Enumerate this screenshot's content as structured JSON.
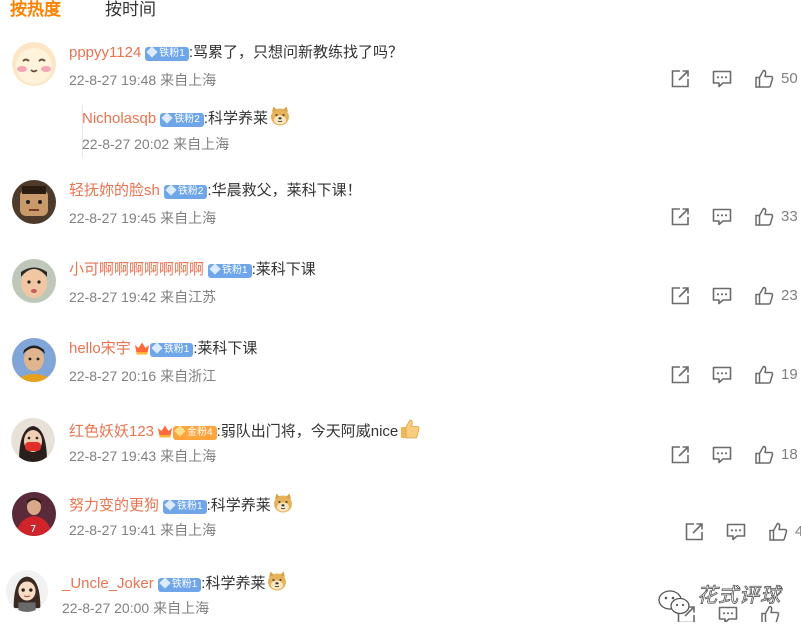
{
  "tabs": {
    "hot": "按热度",
    "time": "按时间"
  },
  "colors": {
    "accent": "#ff8200",
    "username": "#eb7350",
    "badge": "#6fa6ea",
    "gold_badge": "#ffa33b",
    "meta": "#808080"
  },
  "comments": [
    {
      "user": "pppyy1124",
      "badge": "铁粉1",
      "badge_type": "fan",
      "text": ":骂累了，只想问新教练找了吗？",
      "time": "22-8-27 19:48",
      "location": "来自上海",
      "likes": "50",
      "avatar_icon": "blushing-emoji-avatar-icon",
      "reply": {
        "user": "Nicholasqb",
        "badge": "铁粉2",
        "text": ":科学养莱",
        "emoji": "doge-emoji-icon",
        "time": "22-8-27 20:02",
        "location": "来自上海"
      }
    },
    {
      "user": "轻抚妳的脸sh",
      "badge": "铁粉2",
      "badge_type": "fan",
      "text": ":华晨救父，莱科下课！",
      "time": "22-8-27 19:45",
      "location": "来自上海",
      "likes": "33",
      "avatar_icon": "cartoon-face-avatar-icon"
    },
    {
      "user": "小可啊啊啊啊啊啊啊",
      "badge": "铁粉1",
      "badge_type": "fan",
      "text": ":莱科下课",
      "time": "22-8-27 19:42",
      "location": "来自江苏",
      "likes": "23",
      "avatar_icon": "child-photo-avatar-icon"
    },
    {
      "user": "hello宋宇",
      "badge": "铁粉1",
      "badge_type": "fan-crown",
      "text": ":莱科下课",
      "time": "22-8-27 20:16",
      "location": "来自浙江",
      "likes": "19",
      "avatar_icon": "person-photo-avatar-icon"
    },
    {
      "user": "红色妖妖123",
      "badge": "金粉4",
      "badge_type": "gold-crown",
      "text": ":弱队出门将，今天阿威nice",
      "emoji": "thumbs-up-emoji-icon",
      "time": "22-8-27 19:43",
      "location": "来自上海",
      "likes": "18",
      "avatar_icon": "masked-person-avatar-icon"
    },
    {
      "user": "努力变的更狗",
      "badge": "铁粉1",
      "badge_type": "fan",
      "text": ":科学养莱",
      "emoji": "doge-emoji-icon",
      "time": "22-8-27 19:41",
      "location": "来自上海",
      "likes": "4",
      "avatar_icon": "red-jersey-player-avatar-icon"
    },
    {
      "user": "_Uncle_Joker",
      "badge": "铁粉1",
      "badge_type": "fan",
      "text": ":科学养莱",
      "emoji": "doge-emoji-icon",
      "time": "22-8-27 20:00",
      "location": "来自上海",
      "likes": "",
      "avatar_icon": "cartoon-girl-avatar-icon"
    }
  ],
  "watermark": {
    "text": "花式评球",
    "icon": "wechat-logo-icon"
  }
}
